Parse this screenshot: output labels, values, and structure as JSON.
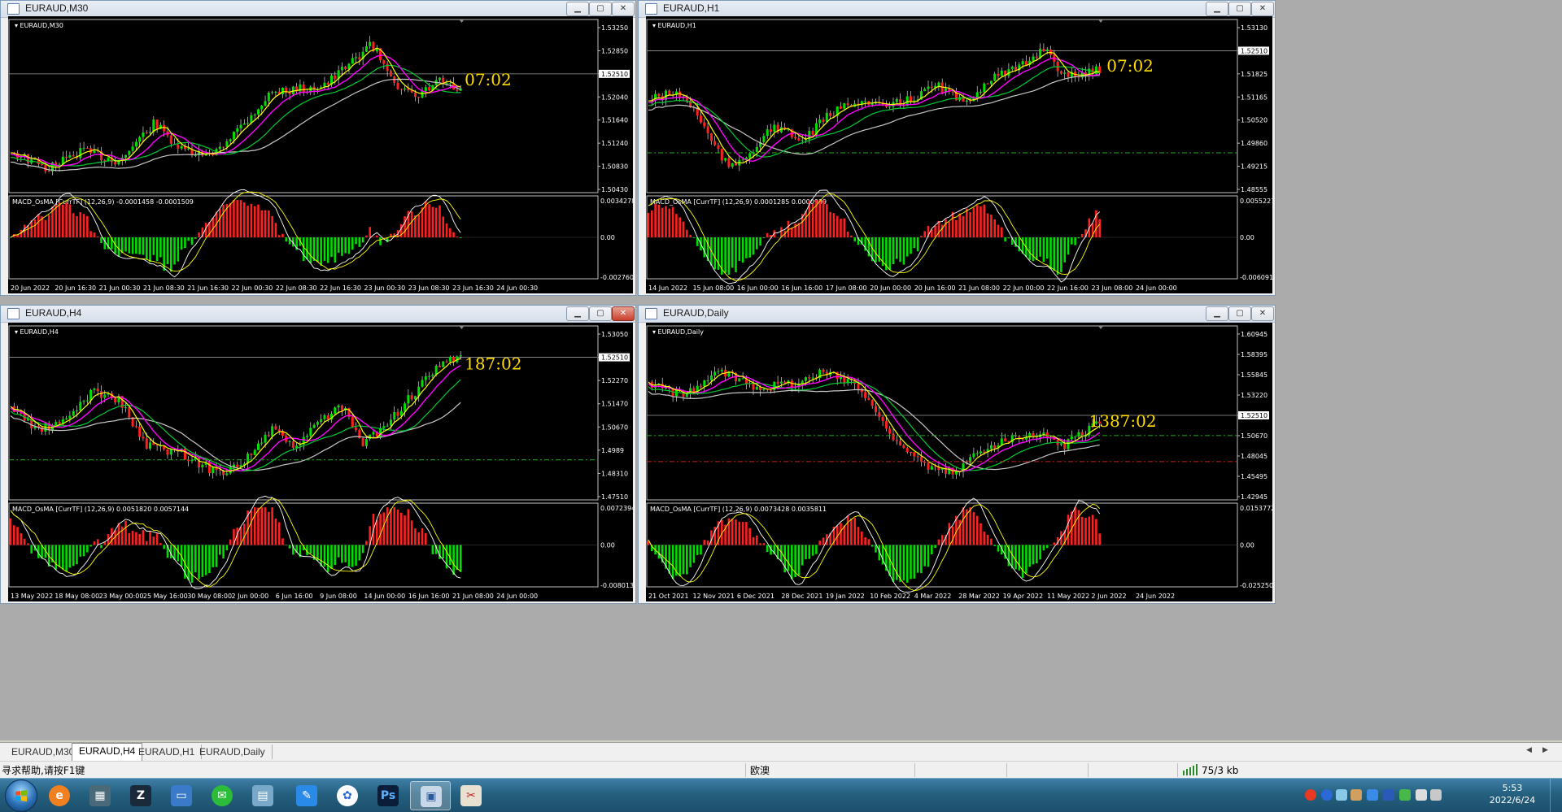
{
  "windows": [
    {
      "title": "EURAUD,M30",
      "chart_label": "EURAUD,M30",
      "timer": "07:02",
      "price_ticks": [
        "1.53250",
        "1.52850",
        "1.52510",
        "1.52040",
        "1.51640",
        "1.51240",
        "1.50830",
        "1.50430"
      ],
      "current_price": "1.52510",
      "indicator_label": "MACD_OsMA [CurrTF] (12,26,9) -0.0001458 -0.0001509",
      "ind_ticks": [
        "0.0034278",
        "0.00",
        "-0.002760"
      ],
      "time_ticks": [
        "20 Jun 2022",
        "20 Jun 16:30",
        "21 Jun 00:30",
        "21 Jun 08:30",
        "21 Jun 16:30",
        "22 Jun 00:30",
        "22 Jun 08:30",
        "22 Jun 16:30",
        "23 Jun 00:30",
        "23 Jun 08:30",
        "23 Jun 16:30",
        "24 Jun 00:30"
      ],
      "close_active": false
    },
    {
      "title": "EURAUD,H1",
      "chart_label": "EURAUD,H1",
      "timer": "07:02",
      "price_ticks": [
        "1.53130",
        "1.52510",
        "1.51825",
        "1.51165",
        "1.50520",
        "1.49860",
        "1.49215",
        "1.48555"
      ],
      "current_price": "1.52510",
      "indicator_label": "MACD_OsMA [CurrTF] (12,26,9) 0.0001285 0.0000999",
      "ind_ticks": [
        "0.0055227",
        "0.00",
        "-0.006091"
      ],
      "time_ticks": [
        "14 Jun 2022",
        "15 Jun 08:00",
        "16 Jun 00:00",
        "16 Jun 16:00",
        "17 Jun 08:00",
        "20 Jun 00:00",
        "20 Jun 16:00",
        "21 Jun 08:00",
        "22 Jun 00:00",
        "22 Jun 16:00",
        "23 Jun 08:00",
        "24 Jun 00:00"
      ],
      "close_active": false
    },
    {
      "title": "EURAUD,H4",
      "chart_label": "EURAUD,H4",
      "timer": "187:02",
      "price_ticks": [
        "1.53050",
        "1.52510",
        "1.52270",
        "1.51470",
        "1.50670",
        "1.4989",
        "1.48310",
        "1.47510"
      ],
      "current_price": "1.52510",
      "indicator_label": "MACD_OsMA [CurrTF] (12,26,9) 0.0051820 0.0057144",
      "ind_ticks": [
        "0.0072394",
        "0.00",
        "-0.008013"
      ],
      "time_ticks": [
        "13 May 2022",
        "18 May 08:00",
        "23 May 00:00",
        "25 May 16:00",
        "30 May 08:00",
        "2 Jun 00:00",
        "6 Jun 16:00",
        "9 Jun 08:00",
        "14 Jun 00:00",
        "16 Jun 16:00",
        "21 Jun 08:00",
        "24 Jun 00:00"
      ],
      "close_active": true
    },
    {
      "title": "EURAUD,Daily",
      "chart_label": "EURAUD,Daily",
      "timer": "1387:02",
      "price_ticks": [
        "1.60945",
        "1.58395",
        "1.55845",
        "1.53220",
        "1.52510",
        "1.50670",
        "1.48045",
        "1.45495",
        "1.42945"
      ],
      "current_price": "1.52510",
      "indicator_label": "MACD_OsMA [CurrTF] (12,26,9) 0.0073428 0.0035811",
      "ind_ticks": [
        "0.0153772",
        "0.00",
        "-0.025250"
      ],
      "time_ticks": [
        "21 Oct 2021",
        "12 Nov 2021",
        "6 Dec 2021",
        "28 Dec 2021",
        "19 Jan 2022",
        "10 Feb 2022",
        "4 Mar 2022",
        "28 Mar 2022",
        "19 Apr 2022",
        "11 May 2022",
        "2 Jun 2022",
        "24 Jun 2022"
      ],
      "close_active": false
    }
  ],
  "tabs": [
    "EURAUD,M30",
    "EURAUD,H4",
    "EURAUD,H1",
    "EURAUD,Daily"
  ],
  "active_tab": "EURAUD,H4",
  "status": {
    "help": "寻求帮助,请按F1键",
    "profile": "欧澳",
    "traffic": "75/3 kb"
  },
  "taskbar": {
    "time": "5:53",
    "date": "2022/6/24"
  },
  "colors": {
    "candle_up": "#00e000",
    "candle_down": "#ff2020",
    "ma_fast": "#ffff00",
    "ma_mid": "#ff00ff",
    "ma_slow": "#00cc33",
    "ma_long": "#c8c8c8",
    "timer": "#ffdd00"
  }
}
